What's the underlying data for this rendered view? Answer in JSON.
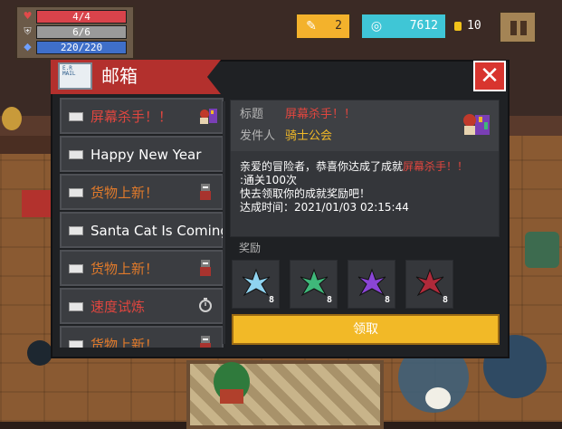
{
  "hud": {
    "health": {
      "text": "4/4",
      "fill": 1.0,
      "color": "#d9434b",
      "icon": "heart-icon"
    },
    "armor": {
      "text": "6/6",
      "fill": 1.0,
      "color": "#9a9a9a",
      "icon": "shield-icon"
    },
    "energy": {
      "text": "220/220",
      "fill": 1.0,
      "color": "#3f6fc9",
      "icon": "gem-icon"
    },
    "materials": {
      "value": "2",
      "icon": "feather-icon",
      "bg": "#f3b22c"
    },
    "gems": {
      "value": "7612",
      "icon": "gem-icon",
      "bg": "#3fc6d6"
    },
    "gold": {
      "value": "10",
      "icon": "coin-icon"
    }
  },
  "mailbox": {
    "title": "邮箱",
    "icon_label": "E.R\nMAIL",
    "list": [
      {
        "title": "屏幕杀手！！",
        "color": "#e0463f",
        "icon": "achievement-icon"
      },
      {
        "title": "Happy New Year",
        "color": "#ffffff",
        "icon": ""
      },
      {
        "title": "货物上新！",
        "color": "#e07a2b",
        "icon": "merchant-icon"
      },
      {
        "title": "Santa Cat Is Coming",
        "color": "#ffffff",
        "icon": ""
      },
      {
        "title": "货物上新！",
        "color": "#e07a2b",
        "icon": "merchant-icon"
      },
      {
        "title": "速度试炼",
        "color": "#e0463f",
        "icon": "stopwatch-icon"
      },
      {
        "title": "货物上新！",
        "color": "#e07a2b",
        "icon": "merchant-icon"
      }
    ],
    "detail": {
      "subject_label": "标题",
      "subject": "屏幕杀手！！",
      "sender_label": "发件人",
      "sender": "骑士公会",
      "body_line1_prefix": "亲爱的冒险者，恭喜你达成了成就",
      "body_line1_highlight": "屏幕杀手！！",
      "body_line2": ":通关100次",
      "body_line3": "快去领取你的成就奖励吧！",
      "body_line4": "达成时间：2021/01/03 02:15:44"
    },
    "rewards_label": "奖励",
    "rewards": [
      {
        "icon": "blue-crystal-icon",
        "count": "8",
        "color": "#8fd3f0"
      },
      {
        "icon": "green-crystal-icon",
        "count": "8",
        "color": "#3fb87a"
      },
      {
        "icon": "purple-crystal-icon",
        "count": "8",
        "color": "#8a45d6"
      },
      {
        "icon": "red-crystal-icon",
        "count": "8",
        "color": "#b02a3a"
      }
    ],
    "claim_label": "领取"
  }
}
